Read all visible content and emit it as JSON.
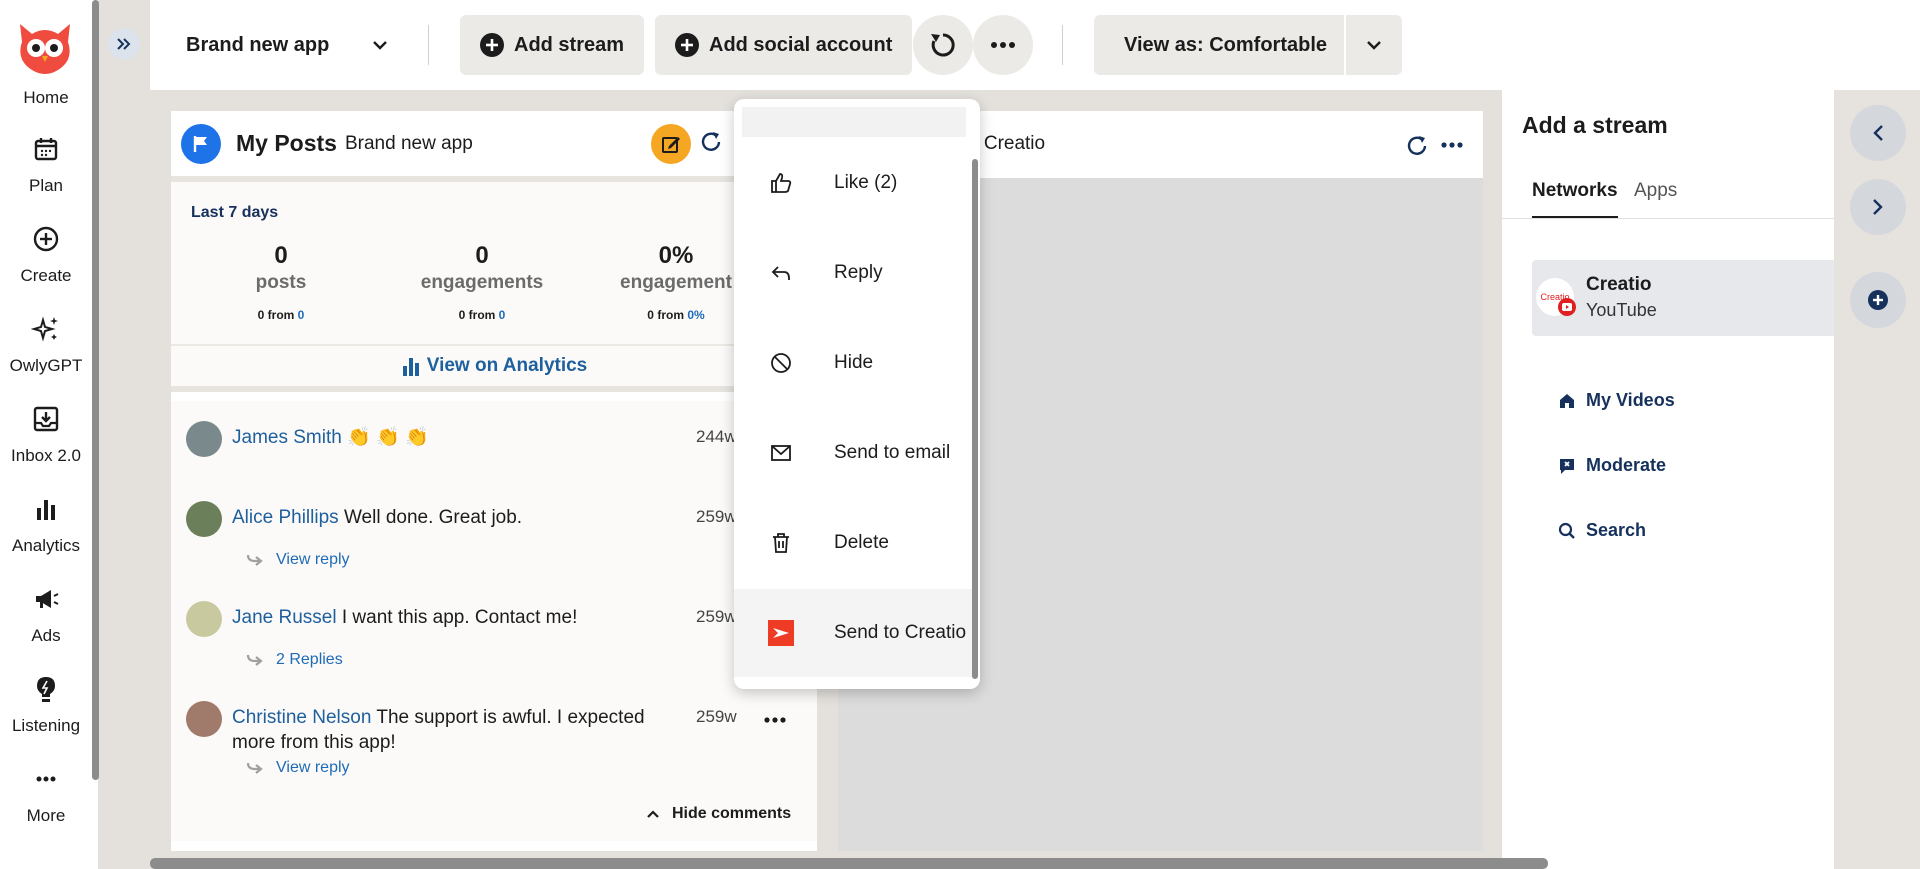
{
  "nav": {
    "items": [
      {
        "label": "Home",
        "icon": "owl-logo-icon"
      },
      {
        "label": "Plan",
        "icon": "calendar-icon"
      },
      {
        "label": "Create",
        "icon": "plus-circle-icon"
      },
      {
        "label": "OwlyGPT",
        "icon": "sparkles-icon"
      },
      {
        "label": "Inbox 2.0",
        "icon": "inbox-icon"
      },
      {
        "label": "Analytics",
        "icon": "bar-chart-icon"
      },
      {
        "label": "Ads",
        "icon": "megaphone-icon"
      },
      {
        "label": "Listening",
        "icon": "lightbulb-icon"
      },
      {
        "label": "More",
        "icon": "more-horizontal-icon"
      }
    ]
  },
  "topbar": {
    "app_name": "Brand new app",
    "add_stream": "Add stream",
    "add_social_account": "Add social account",
    "view_as": "View as: Comfortable"
  },
  "stream1": {
    "title": "My Posts",
    "subtitle": "Brand new app",
    "period": "Last 7 days",
    "stats": [
      {
        "value": "0",
        "name": "posts",
        "from_label": "from",
        "from_base": "0",
        "from_value": "0"
      },
      {
        "value": "0",
        "name": "engagements",
        "from_label": "from",
        "from_base": "0",
        "from_value": "0"
      },
      {
        "value": "0%",
        "name": "engagement",
        "from_label": "from",
        "from_base": "0",
        "from_value": "0%"
      }
    ],
    "analytics_link": "View on Analytics",
    "comments": [
      {
        "author": "James Smith",
        "text": "👏 👏 👏",
        "age": "244w"
      },
      {
        "author": "Alice Phillips",
        "text": "Well done. Great job.",
        "age": "259w",
        "reply": "View reply"
      },
      {
        "author": "Jane Russel",
        "text": "I want this app. Contact me!",
        "age": "259w",
        "reply": "2 Replies"
      },
      {
        "author": "Christine Nelson",
        "text": "The support is awful. I expected more from this app!",
        "age": "259w",
        "reply": "View reply"
      }
    ],
    "hide_comments": "Hide comments"
  },
  "stream2": {
    "title_partial": "o Creatio"
  },
  "menu": {
    "items": [
      {
        "label": "Like (2)",
        "icon": "thumbs-up-icon"
      },
      {
        "label": "Reply",
        "icon": "reply-icon"
      },
      {
        "label": "Hide",
        "icon": "hide-icon"
      },
      {
        "label": "Send to email",
        "icon": "mail-icon"
      },
      {
        "label": "Delete",
        "icon": "trash-icon"
      },
      {
        "label": "Send to Creatio",
        "icon": "creatio-icon"
      }
    ]
  },
  "right_panel": {
    "title": "Add a stream",
    "tabs": [
      "Networks",
      "Apps"
    ],
    "app": {
      "name": "Creatio",
      "network": "YouTube",
      "logo_text": "Creatio"
    },
    "links": [
      "My Videos",
      "Moderate",
      "Search"
    ]
  },
  "colors": {
    "brand_blue": "#1e73e8",
    "link_blue": "#1e5f9e",
    "accent_orange": "#f5a623",
    "creatio_red": "#ee3b24",
    "owl_red": "#ef4b3f"
  }
}
